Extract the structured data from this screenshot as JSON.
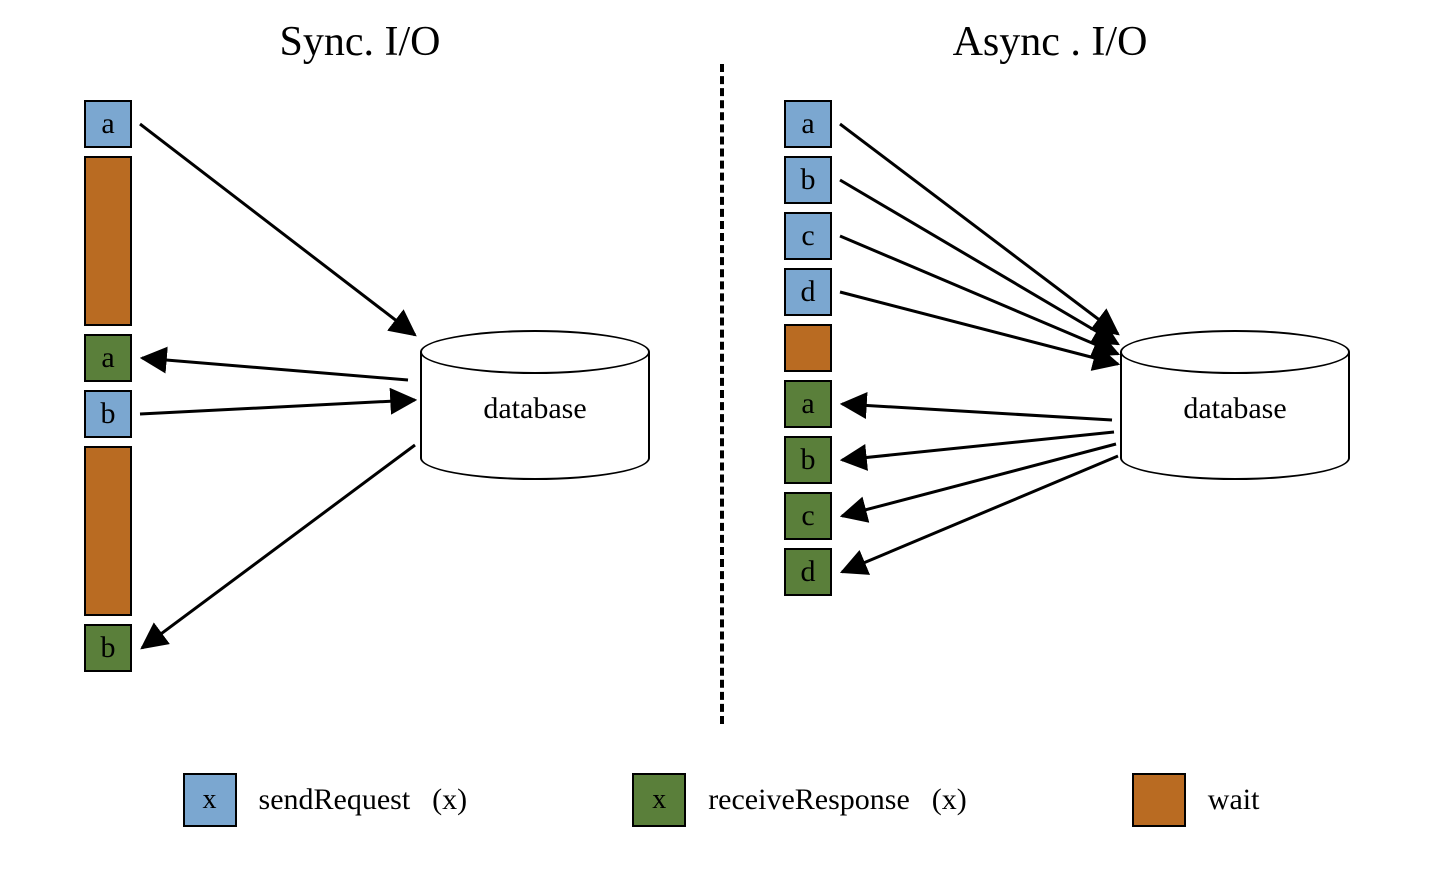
{
  "titles": {
    "left": "Sync. I/O",
    "right": "Async . I/O"
  },
  "colors": {
    "send": "#7ba7d0",
    "recv": "#5a7f3a",
    "wait": "#b96b22"
  },
  "legend": {
    "send": {
      "glyph": "x",
      "label": "sendRequest",
      "suffix": "(x)"
    },
    "recv": {
      "glyph": "x",
      "label": "receiveResponse",
      "suffix": "(x)"
    },
    "wait": {
      "glyph": "",
      "label": "wait",
      "suffix": ""
    }
  },
  "database_label": "database",
  "sync": {
    "timeline": [
      {
        "kind": "send",
        "label": "a"
      },
      {
        "kind": "wait",
        "label": ""
      },
      {
        "kind": "recv",
        "label": "a"
      },
      {
        "kind": "send",
        "label": "b"
      },
      {
        "kind": "wait",
        "label": ""
      },
      {
        "kind": "recv",
        "label": "b"
      }
    ],
    "arrows": [
      {
        "dir": "to_db",
        "from_step": 0
      },
      {
        "dir": "from_db",
        "from_step": 2
      },
      {
        "dir": "to_db",
        "from_step": 3
      },
      {
        "dir": "from_db",
        "from_step": 5
      }
    ]
  },
  "async": {
    "timeline": [
      {
        "kind": "send",
        "label": "a"
      },
      {
        "kind": "send",
        "label": "b"
      },
      {
        "kind": "send",
        "label": "c"
      },
      {
        "kind": "send",
        "label": "d"
      },
      {
        "kind": "wait",
        "label": ""
      },
      {
        "kind": "recv",
        "label": "a"
      },
      {
        "kind": "recv",
        "label": "b"
      },
      {
        "kind": "recv",
        "label": "c"
      },
      {
        "kind": "recv",
        "label": "d"
      }
    ],
    "arrows": [
      {
        "dir": "to_db",
        "from_step": 0
      },
      {
        "dir": "to_db",
        "from_step": 1
      },
      {
        "dir": "to_db",
        "from_step": 2
      },
      {
        "dir": "to_db",
        "from_step": 3
      },
      {
        "dir": "from_db",
        "from_step": 5
      },
      {
        "dir": "from_db",
        "from_step": 6
      },
      {
        "dir": "from_db",
        "from_step": 7
      },
      {
        "dir": "from_db",
        "from_step": 8
      }
    ]
  }
}
